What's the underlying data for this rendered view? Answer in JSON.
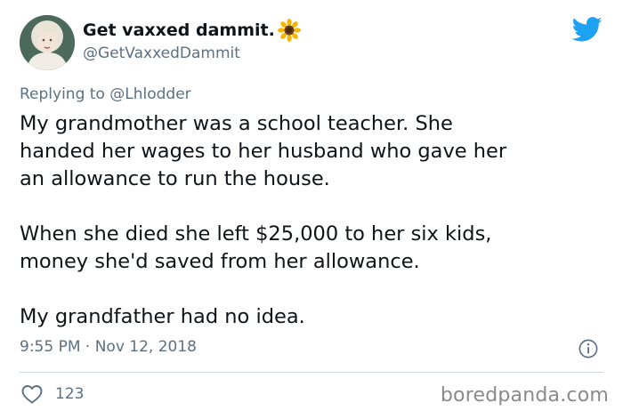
{
  "author": {
    "display_name": "Get vaxxed dammit.",
    "emoji": "sunflower",
    "handle": "@GetVaxxedDammit"
  },
  "reply": {
    "prefix": "Replying to",
    "mention": "@Lhlodder"
  },
  "tweet": {
    "paragraphs": [
      {
        "lines": [
          "My grandmother was a school teacher. She",
          "handed her wages to her husband who gave her",
          "an allowance to run the house."
        ]
      },
      {
        "lines": [
          "When she died she left $25,000 to her six kids,",
          "money she'd saved from her allowance."
        ]
      },
      {
        "lines": [
          "My grandfather had no idea."
        ]
      }
    ],
    "timestamp": "9:55 PM · Nov 12, 2018",
    "likes": "123"
  },
  "watermark": "boredpanda.com",
  "icons": {
    "logo": "twitter-bird-icon",
    "info": "info-icon",
    "like": "heart-icon"
  },
  "colors": {
    "twitter_blue": "#1da1f2",
    "secondary_text": "#5b7083",
    "primary_text": "#0f1419",
    "divider": "#cfd9de"
  }
}
